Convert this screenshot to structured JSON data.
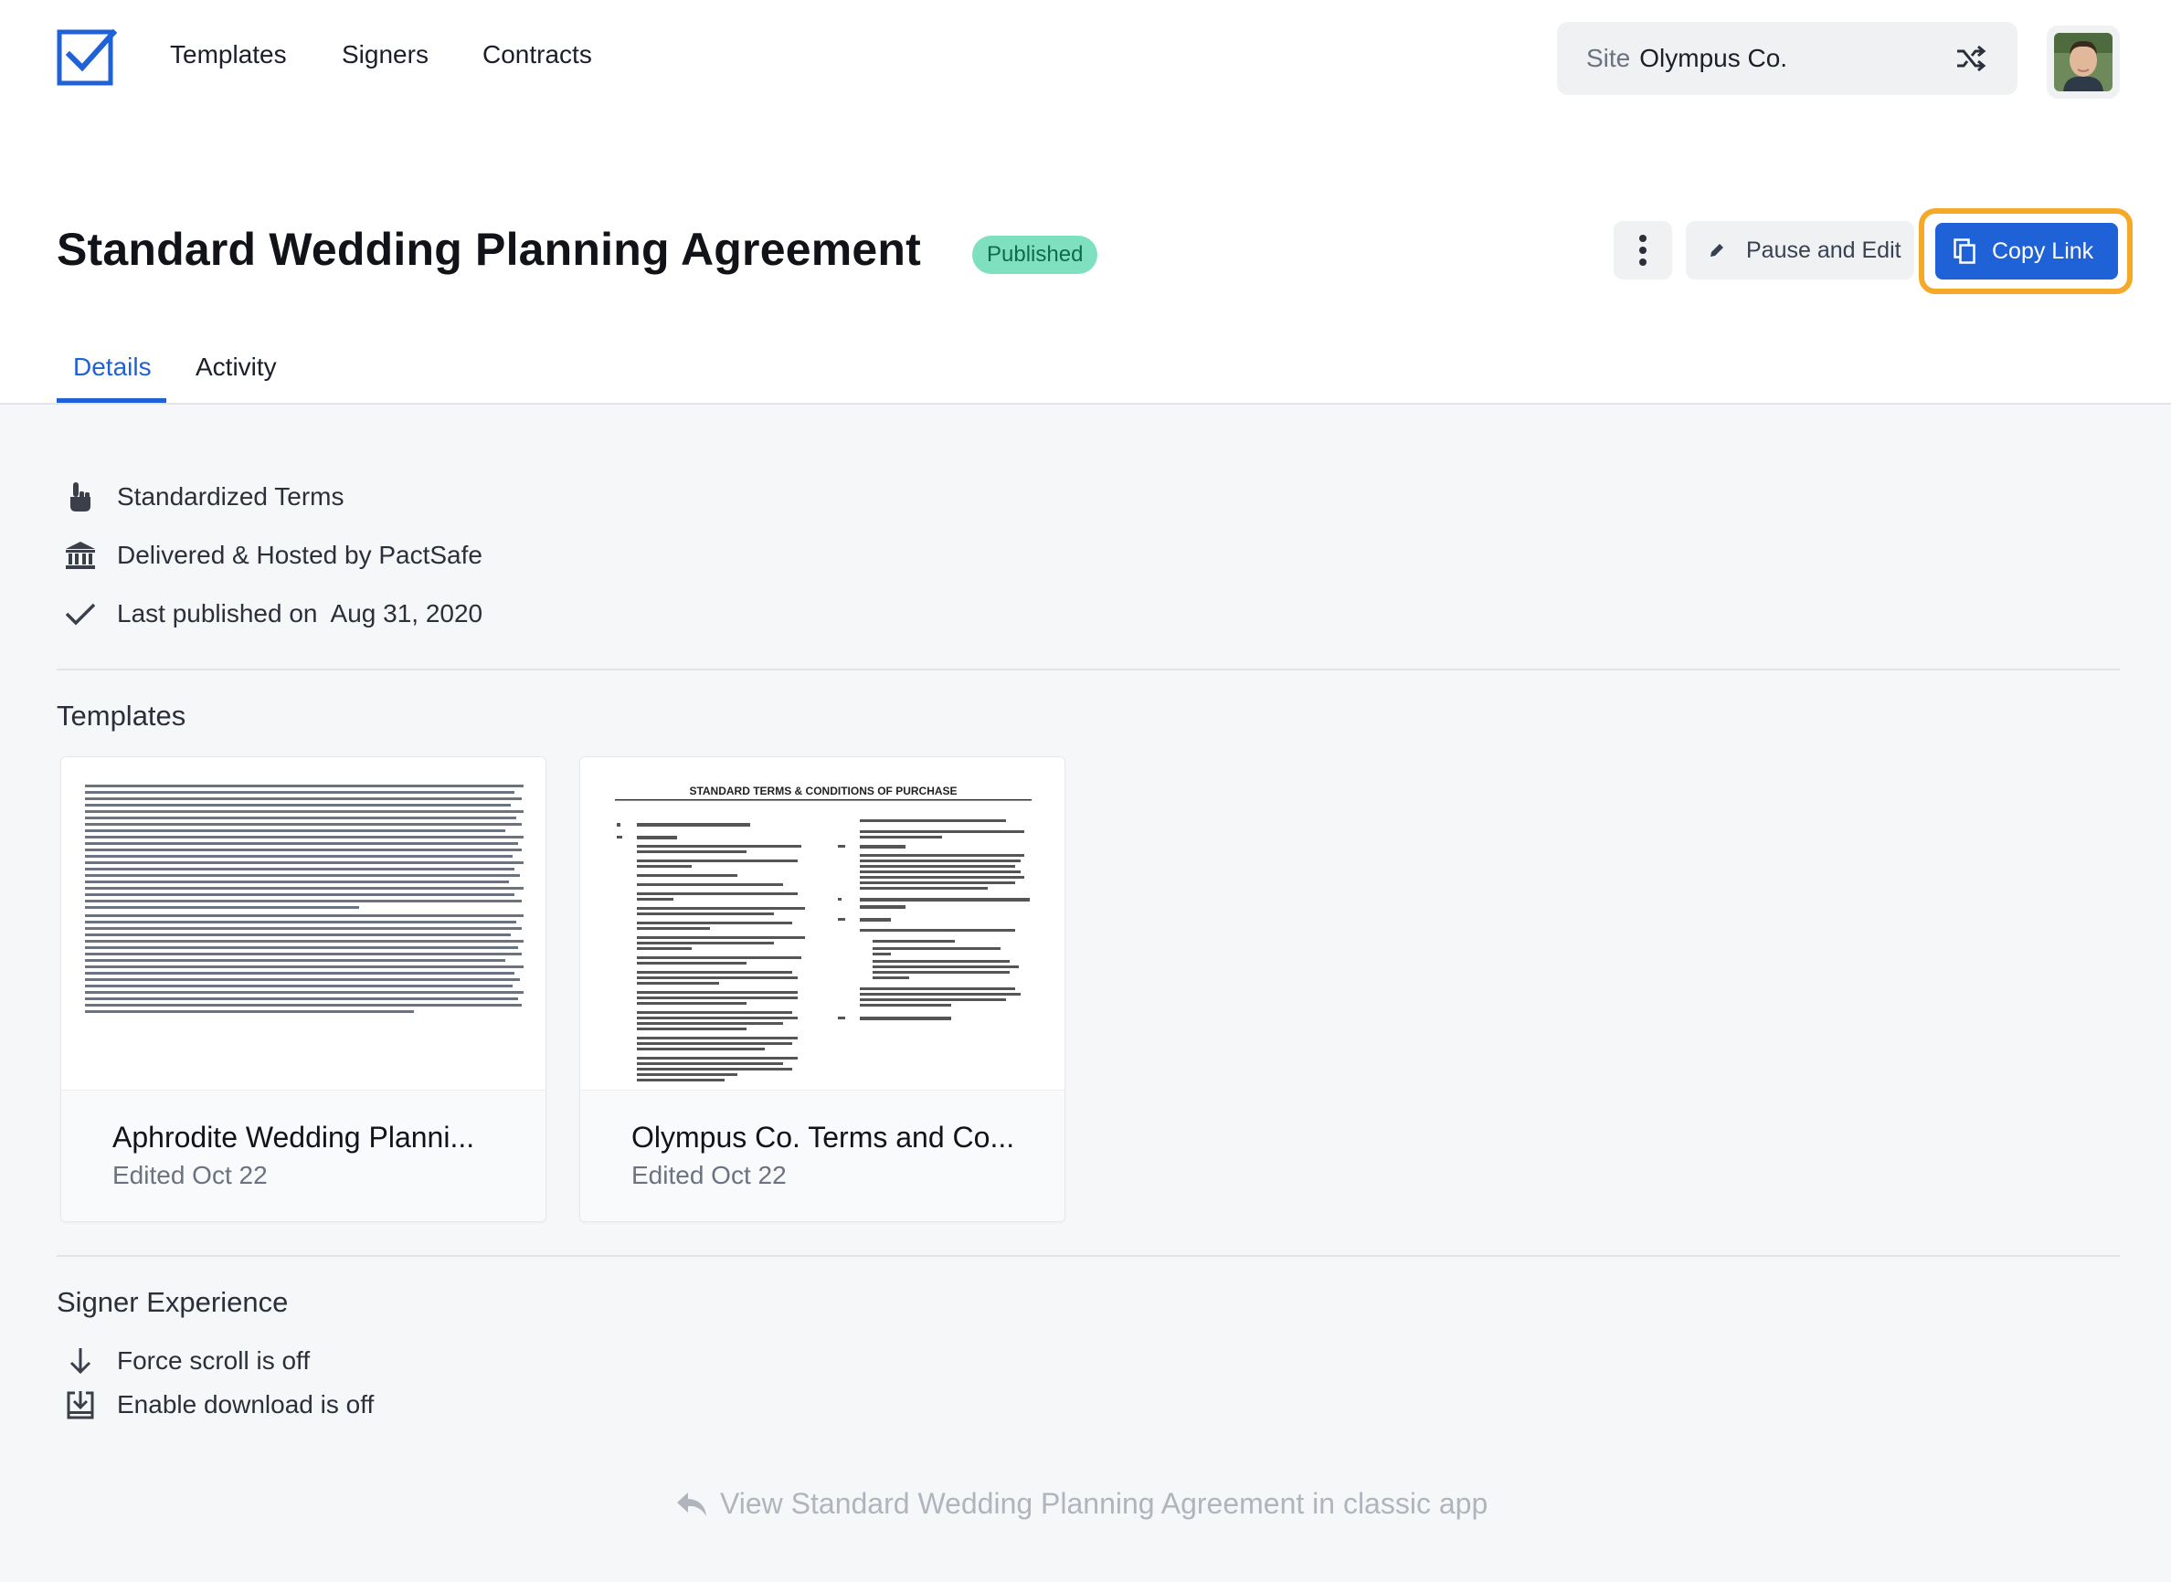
{
  "nav": {
    "items": [
      {
        "label": "Templates"
      },
      {
        "label": "Signers"
      },
      {
        "label": "Contracts"
      }
    ],
    "site_label": "Site",
    "site_name": "Olympus Co."
  },
  "header": {
    "title": "Standard Wedding Planning Agreement",
    "status": "Published",
    "pause_label": "Pause and Edit",
    "copy_label": "Copy Link"
  },
  "tabs": [
    {
      "label": "Details",
      "active": true
    },
    {
      "label": "Activity",
      "active": false
    }
  ],
  "details": {
    "terms_type": "Standardized Terms",
    "delivery": "Delivered & Hosted by PactSafe",
    "published_label": "Last published on",
    "published_date": "Aug 31, 2020"
  },
  "templates": {
    "section_title": "Templates",
    "items": [
      {
        "title": "Aphrodite Wedding Planni...",
        "edited": "Edited Oct 22"
      },
      {
        "title": "Olympus Co. Terms and Co...",
        "edited": "Edited Oct 22",
        "doc_heading": "STANDARD TERMS & CONDITIONS OF PURCHASE"
      }
    ]
  },
  "signer_experience": {
    "section_title": "Signer Experience",
    "force_scroll": "Force scroll is off",
    "enable_download": "Enable download is off"
  },
  "footer": {
    "classic_link": "View Standard Wedding Planning Agreement in classic app"
  },
  "colors": {
    "accent": "#1f61d6",
    "focus_ring": "#f4a928",
    "published_badge": "#7fe0bf"
  },
  "icons": {
    "logo": "checkbox-logo-icon",
    "site_switch": "shuffle-icon",
    "kebab": "more-vertical-icon",
    "pause": "pencil-icon",
    "copy": "copy-icon",
    "terms": "hand-pointer-icon",
    "delivery": "bank-icon",
    "published": "check-icon",
    "scroll": "arrow-down-icon",
    "download": "download-icon",
    "classic": "reply-arrow-icon"
  }
}
